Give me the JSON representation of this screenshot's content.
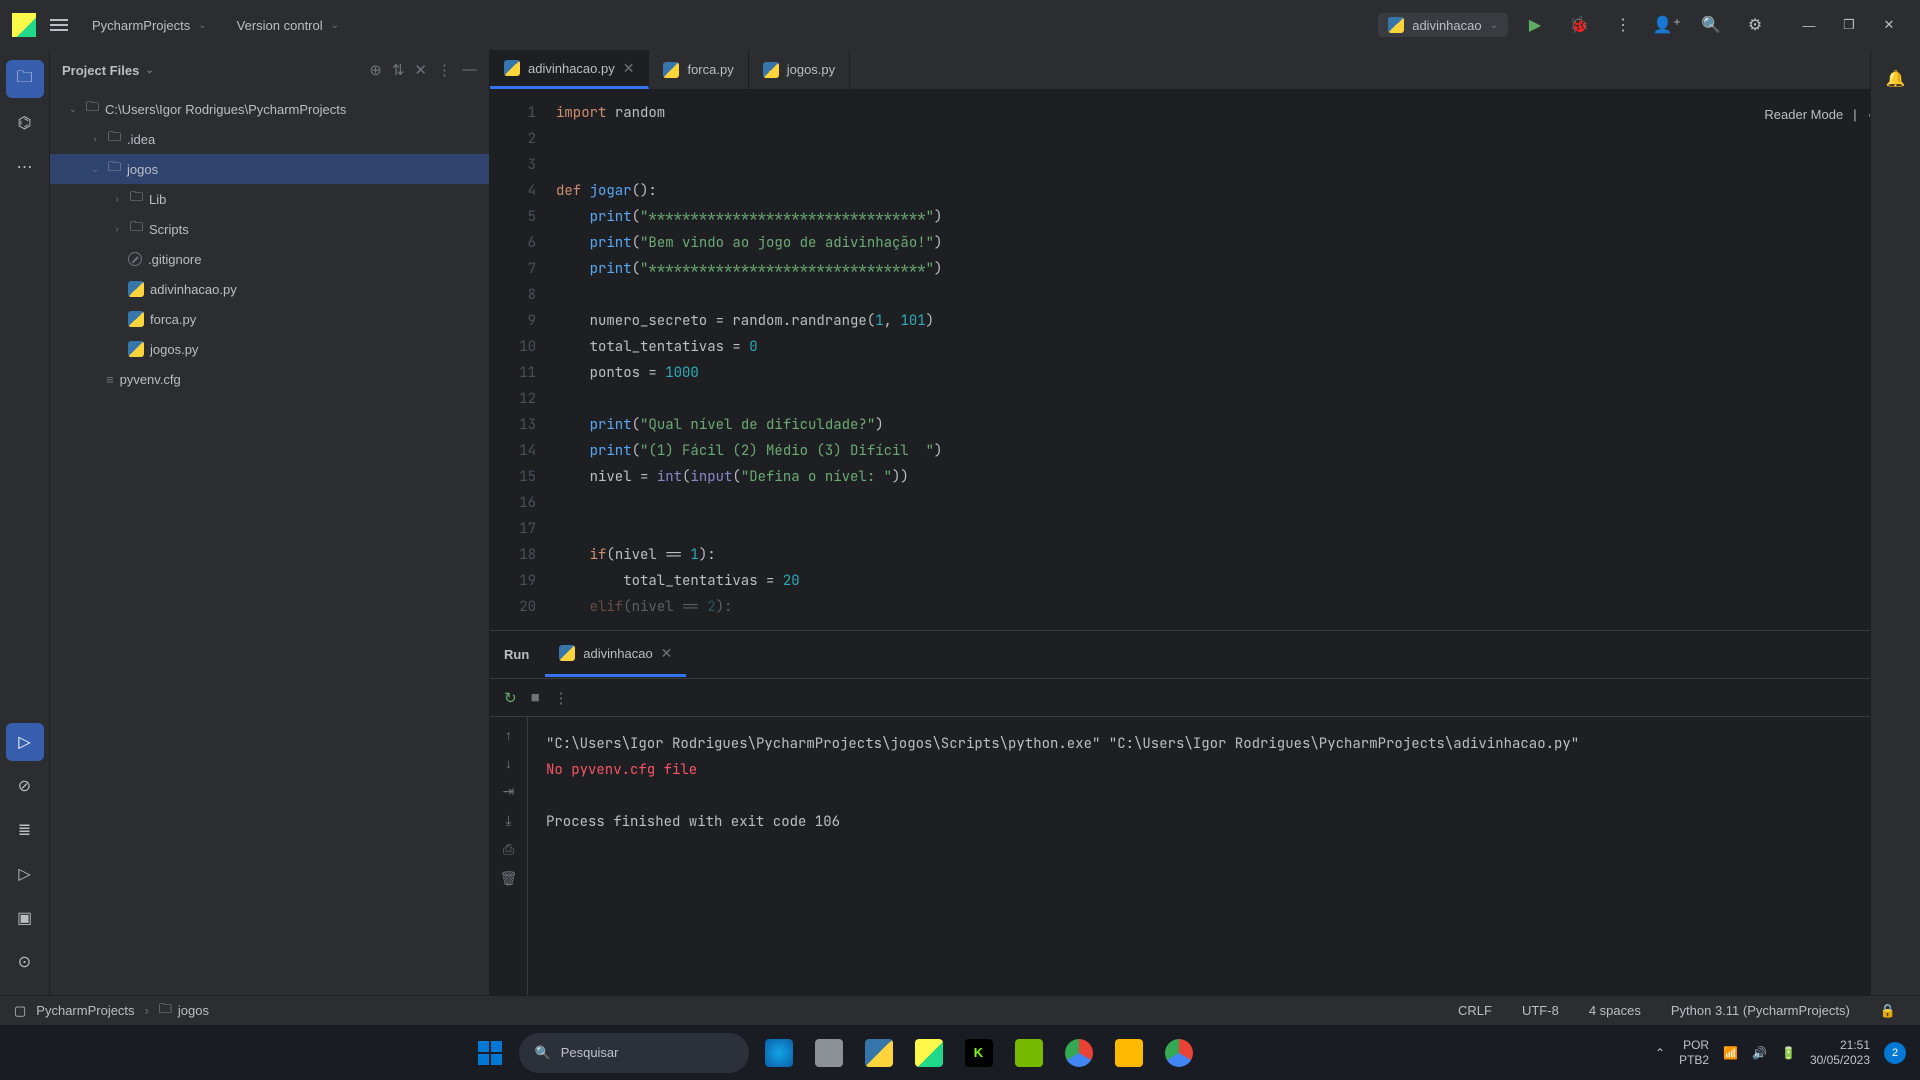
{
  "titlebar": {
    "project": "PycharmProjects",
    "vcs": "Version control",
    "run_config": "adivinhacao"
  },
  "project_panel": {
    "title": "Project Files",
    "root": "C:\\Users\\Igor Rodrigues\\PycharmProjects",
    "items": {
      "idea": ".idea",
      "jogos": "jogos",
      "lib": "Lib",
      "scripts": "Scripts",
      "gitignore": ".gitignore",
      "adivinhacao": "adivinhacao.py",
      "forca": "forca.py",
      "jogospy": "jogos.py",
      "pyvenv": "pyvenv.cfg"
    }
  },
  "tabs": {
    "t1": "adivinhacao.py",
    "t2": "forca.py",
    "t3": "jogos.py"
  },
  "reader_mode": "Reader Mode",
  "gutter": [
    "1",
    "2",
    "3",
    "4",
    "5",
    "6",
    "7",
    "8",
    "9",
    "10",
    "11",
    "12",
    "13",
    "14",
    "15",
    "16",
    "17",
    "18",
    "19",
    "20"
  ],
  "code": {
    "l1_import": "import ",
    "l1_random": "random",
    "l4_def": "def ",
    "l4_fn": "jogar",
    "l4_paren": "():",
    "l5_print": "print",
    "l5_str": "\"*********************************\"",
    "l6_print": "print",
    "l6_str": "\"Bem vindo ao jogo de adivinhação!\"",
    "l7_print": "print",
    "l7_str": "\"*********************************\"",
    "l9a": "numero_secreto = random.randrange(",
    "l9n1": "1",
    "l9c": ", ",
    "l9n2": "101",
    "l9b": ")",
    "l10a": "total_tentativas = ",
    "l10n": "0",
    "l11a": "pontos = ",
    "l11n": "1000",
    "l13_print": "print",
    "l13_str": "\"Qual nível de dificuldade?\"",
    "l14_print": "print",
    "l14_str": "\"(1) Fácil (2) Médio (3) Difícil  \"",
    "l15a": "nivel = ",
    "l15_int": "int",
    "l15b": "(",
    "l15_input": "input",
    "l15c": "(",
    "l15_str": "\"Defina o nível: \"",
    "l15d": "))",
    "l18_if": "if",
    "l18a": "(nivel == ",
    "l18n": "1",
    "l18b": "):",
    "l19a": "total_tentativas = ",
    "l19n": "20",
    "l20_elif": "elif",
    "l20a": "(nivel == ",
    "l20n": "2",
    "l20b": "):"
  },
  "run": {
    "title": "Run",
    "tab": "adivinhacao",
    "cmd": "\"C:\\Users\\Igor Rodrigues\\PycharmProjects\\jogos\\Scripts\\python.exe\" \"C:\\Users\\Igor Rodrigues\\PycharmProjects\\adivinhacao.py\"",
    "err": "No pyvenv.cfg file",
    "exit": "Process finished with exit code 106"
  },
  "breadcrumb": {
    "b1": "PycharmProjects",
    "b2": "jogos"
  },
  "status": {
    "crlf": "CRLF",
    "encoding": "UTF-8",
    "indent": "4 spaces",
    "interpreter": "Python 3.11 (PycharmProjects)"
  },
  "taskbar": {
    "search": "Pesquisar",
    "lang1": "POR",
    "lang2": "PTB2",
    "time": "21:51",
    "date": "30/05/2023",
    "notif_count": "2"
  }
}
